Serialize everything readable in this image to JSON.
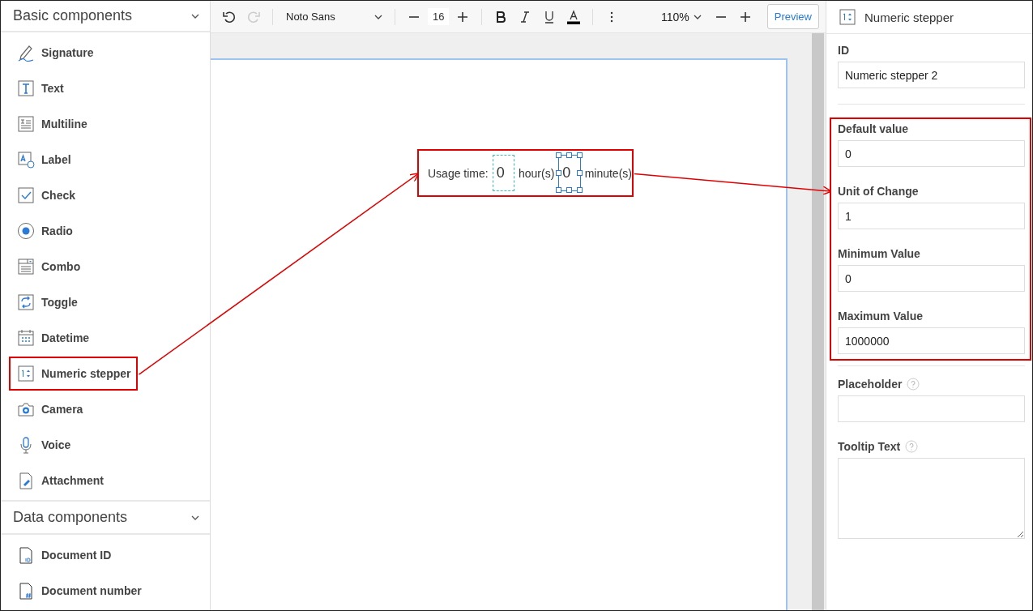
{
  "sidebar": {
    "sections": [
      {
        "title": "Basic components",
        "expanded": true,
        "items": [
          {
            "label": "Signature",
            "kind": "signature",
            "highlighted": false
          },
          {
            "label": "Text",
            "kind": "text",
            "highlighted": false
          },
          {
            "label": "Multiline",
            "kind": "multiline",
            "highlighted": false
          },
          {
            "label": "Label",
            "kind": "label",
            "highlighted": false
          },
          {
            "label": "Check",
            "kind": "check",
            "highlighted": false
          },
          {
            "label": "Radio",
            "kind": "radio",
            "highlighted": false
          },
          {
            "label": "Combo",
            "kind": "combo",
            "highlighted": false
          },
          {
            "label": "Toggle",
            "kind": "toggle",
            "highlighted": false
          },
          {
            "label": "Datetime",
            "kind": "datetime",
            "highlighted": false
          },
          {
            "label": "Numeric stepper",
            "kind": "stepper",
            "highlighted": true
          },
          {
            "label": "Camera",
            "kind": "camera",
            "highlighted": false
          },
          {
            "label": "Voice",
            "kind": "voice",
            "highlighted": false
          },
          {
            "label": "Attachment",
            "kind": "attachment",
            "highlighted": false
          }
        ]
      },
      {
        "title": "Data components",
        "expanded": true,
        "items": [
          {
            "label": "Document ID",
            "kind": "docid",
            "highlighted": false
          },
          {
            "label": "Document number",
            "kind": "docnum",
            "highlighted": false
          }
        ]
      }
    ]
  },
  "toolbar": {
    "redo_disabled": true,
    "font": "Noto Sans",
    "font_size": "16",
    "zoom": "110%",
    "preview": "Preview"
  },
  "canvas": {
    "element": {
      "highlighted": true,
      "parts": [
        {
          "kind": "label",
          "text": "Usage time:"
        },
        {
          "kind": "stepper",
          "value": "0",
          "selected": false
        },
        {
          "kind": "label",
          "text": "hour(s)"
        },
        {
          "kind": "stepper",
          "value": "0",
          "selected": true
        },
        {
          "kind": "label",
          "text": "minute(s)"
        }
      ]
    }
  },
  "properties": {
    "title": "Numeric stepper",
    "id": {
      "label": "ID",
      "value": "Numeric stepper 2"
    },
    "group": {
      "highlighted": true,
      "fields": [
        {
          "label": "Default value",
          "value": "0"
        },
        {
          "label": "Unit of Change",
          "value": "1"
        },
        {
          "label": "Minimum Value",
          "value": "0"
        },
        {
          "label": "Maximum Value",
          "value": "1000000"
        }
      ]
    },
    "other_fields": [
      {
        "label": "Placeholder",
        "kind": "input",
        "help": true
      },
      {
        "label": "Tooltip Text",
        "kind": "textarea",
        "help": true
      }
    ]
  }
}
